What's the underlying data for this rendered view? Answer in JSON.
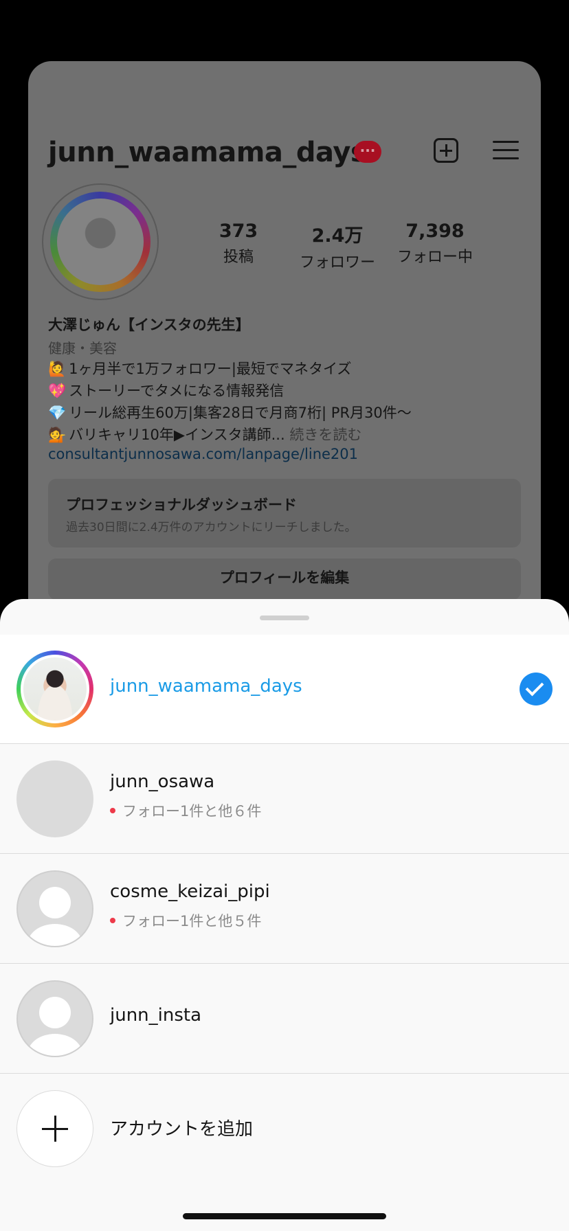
{
  "profile": {
    "username": "junn_waamama_days",
    "notification_badge": "···",
    "stats": [
      {
        "value": "373",
        "label": "投稿"
      },
      {
        "value": "2.4万",
        "label": "フォロワー"
      },
      {
        "value": "7,398",
        "label": "フォロー中"
      }
    ],
    "display_name": "大澤じゅん【インスタの先生】",
    "category": "健康・美容",
    "bio_lines": [
      {
        "emoji": "🙋",
        "text": "1ヶ月半で1万フォロワー|最短でマネタイズ"
      },
      {
        "emoji": "💖",
        "text": "ストーリーでタメになる情報発信"
      },
      {
        "emoji": "💎",
        "text": "リール総再生60万|集客28日で月商7桁| PR月30件〜"
      },
      {
        "emoji": "💁",
        "text": "バリキャリ10年▶インスタ講師..."
      }
    ],
    "read_more": "続きを読む",
    "link": "consultantjunnosawa.com/lanpage/line201",
    "dashboard": {
      "title": "プロフェッショナルダッシュボード",
      "subtitle": "過去30日間に2.4万件のアカウントにリーチしました。"
    },
    "edit_profile_label": "プロフィールを編集"
  },
  "account_switcher": {
    "accounts": [
      {
        "username": "junn_waamama_days",
        "selected": true
      },
      {
        "username": "junn_osawa",
        "subtitle": "フォロー1件と他６件"
      },
      {
        "username": "cosme_keizai_pipi",
        "subtitle": "フォロー1件と他５件"
      },
      {
        "username": "junn_insta"
      }
    ],
    "add_account_label": "アカウントを追加"
  },
  "colors": {
    "active_account": "#1a9be6",
    "check_badge": "#1a8cf0",
    "notification_dot": "#ed3a4a"
  }
}
